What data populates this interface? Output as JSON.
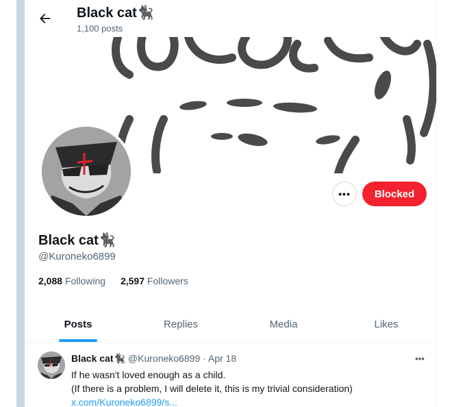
{
  "header": {
    "title": "Black cat🐈‍⬛",
    "post_count": "1,100 posts"
  },
  "profile": {
    "name": "Black cat🐈‍⬛",
    "handle": "@Kuroneko6899",
    "following_count": "2,088",
    "following_label": "Following",
    "followers_count": "2,597",
    "followers_label": "Followers",
    "more_label": "•••",
    "blocked_label": "Blocked"
  },
  "tabs": [
    {
      "label": "Posts",
      "active": true
    },
    {
      "label": "Replies",
      "active": false
    },
    {
      "label": "Media",
      "active": false
    },
    {
      "label": "Likes",
      "active": false
    }
  ],
  "post": {
    "name": "Black cat🐈‍⬛",
    "handle_date": "@Kuroneko6899 · Apr 18",
    "line1": "If he wasn't loved enough as a child.",
    "line2": "(If there is a problem, I will delete it, this is my trivial consideration)",
    "link": "x.com/Kuroneko6899/s...",
    "more_label": "•••"
  },
  "colors": {
    "accent": "#1d9bf0",
    "blocked": "#f4212e",
    "secondary_text": "#536471",
    "scrollbar": "#c7d6e0"
  },
  "icons": {
    "back": "arrow-left-icon",
    "more": "more-horizontal-icon"
  }
}
